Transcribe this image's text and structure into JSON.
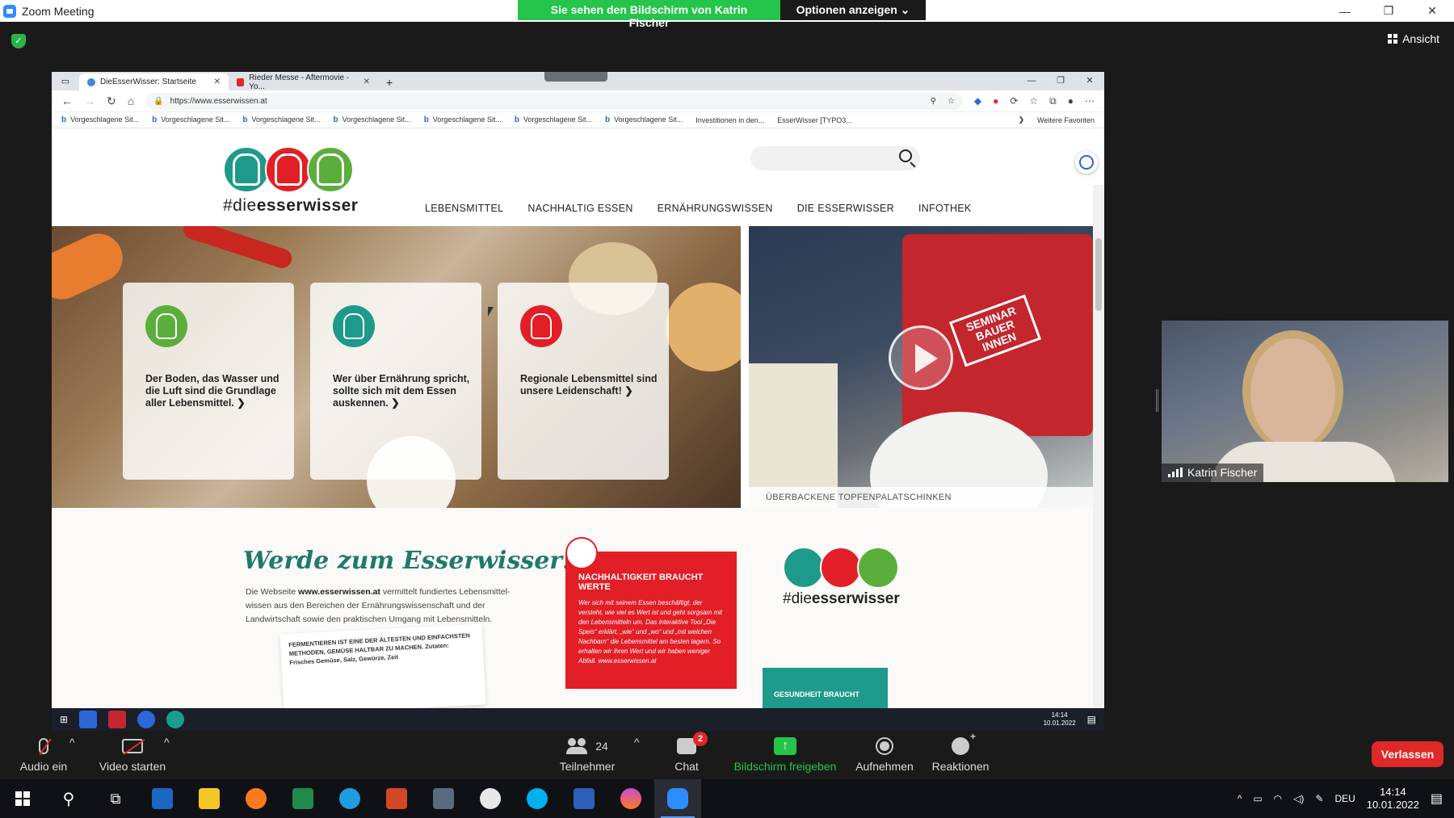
{
  "zoom": {
    "window_title": "Zoom Meeting",
    "share_banner": "Sie sehen den Bildschirm von Katrin Fischer",
    "options_button": "Optionen anzeigen ⌄",
    "view_button": "Ansicht",
    "minimize": "—",
    "restore": "❐",
    "close": "✕"
  },
  "browser": {
    "tabs": [
      {
        "label": "DieEsserWisser: Startseite",
        "color": "#3a8bd9"
      },
      {
        "label": "Rieder Messe - Aftermovie - Yo...",
        "color": "#e02828"
      }
    ],
    "new_tab": "+",
    "url": "https://www.esserwissen.at",
    "favorites": [
      "Vorgeschlagene Sit...",
      "Vorgeschlagene Sit...",
      "Vorgeschlagene Sit...",
      "Vorgeschlagene Sit...",
      "Vorgeschlagene Sit...",
      "Vorgeschlagene Sit...",
      "Vorgeschlagene Sit...",
      "Investitionen in den...",
      "EsserWisser [TYPO3..."
    ],
    "more_favorites": "Weitere Favoriten"
  },
  "site": {
    "logo_prefix": "#die",
    "logo_bold": "esserwisser",
    "nav": [
      "LEBENSMITTEL",
      "NACHHALTIG ESSEN",
      "ERNÄHRUNGSWISSEN",
      "DIE ESSERWISSER",
      "INFOTHEK"
    ],
    "cards": [
      {
        "text": "Der Boden, das Wasser und die Luft sind die Grundlage aller Lebensmittel.  ❯",
        "color": "#5cae3c"
      },
      {
        "text": "Wer über Ernährung spricht, sollte sich mit dem Essen auskennen.  ❯",
        "color": "#1d9a8a"
      },
      {
        "text": "Regionale Lebensmittel sind unsere Leidenschaft!  ❯",
        "color": "#e21f26"
      }
    ],
    "video_stamp": "SEMINAR BAUER INNEN",
    "video_caption": "ÜBERBACKENE TOPFENPALATSCHINKEN",
    "werde_title": "Werde zum Esserwisser!",
    "werde_text_a": "Die Webseite ",
    "werde_text_b": "www.esserwissen.at",
    "werde_text_c": " vermittelt fundiertes Lebensmittel-wissen aus den Bereichen der Ernährungswissenschaft und der Landwirtschaft sowie den praktischen Umgang mit Lebensmitteln.",
    "paper_text": "FERMENTIEREN IST EINE DER ÄLTESTEN UND EINFACHSTEN METHODEN, GEMÜSE HALTBAR ZU MACHEN. Zutaten: Frisches Gemüse, Salz, Gewürze, Zeit",
    "red_heading": "NACHHALTIGKEIT BRAUCHT WERTE",
    "red_body": "Wer sich mit seinem Essen beschäftigt, der versteht, wie viel es Wert ist und geht sorgsam mit den Lebensmitteln um. Das interaktive Tool „Die Speis“ erklärt, „wie“ und „wo“ und „mit welchen Nachbarn“ die Lebensmittel am besten lagern. So erhalten wir ihren Wert und wir haben weniger Abfall. www.esserwissen.at",
    "teal_text": "GESUNDHEIT BRAUCHT"
  },
  "inner_clock": {
    "time": "14:14",
    "date": "10.01.2022"
  },
  "participant": {
    "name": "Katrin Fischer"
  },
  "toolbar": {
    "audio": "Audio ein",
    "video": "Video starten",
    "participants": "Teilnehmer",
    "participants_count": "24",
    "chat": "Chat",
    "chat_badge": "2",
    "share": "Bildschirm freigeben",
    "record": "Aufnehmen",
    "reactions": "Reaktionen",
    "leave": "Verlassen"
  },
  "taskbar": {
    "lang": "DEU",
    "time": "14:14",
    "date": "10.01.2022",
    "apps": [
      "outlook-icon",
      "explorer-icon",
      "firefox-icon",
      "excel-icon",
      "edge-icon",
      "powerpoint-icon",
      "calculator-icon",
      "snipping-icon",
      "skype-icon",
      "word-icon",
      "drop-icon",
      "zoom-icon"
    ]
  },
  "colors": {
    "zoom_green": "#25c44a",
    "leave_red": "#e02828",
    "teal": "#1d9a8a",
    "brand_red": "#e21f26",
    "brand_green": "#5cae3c"
  }
}
